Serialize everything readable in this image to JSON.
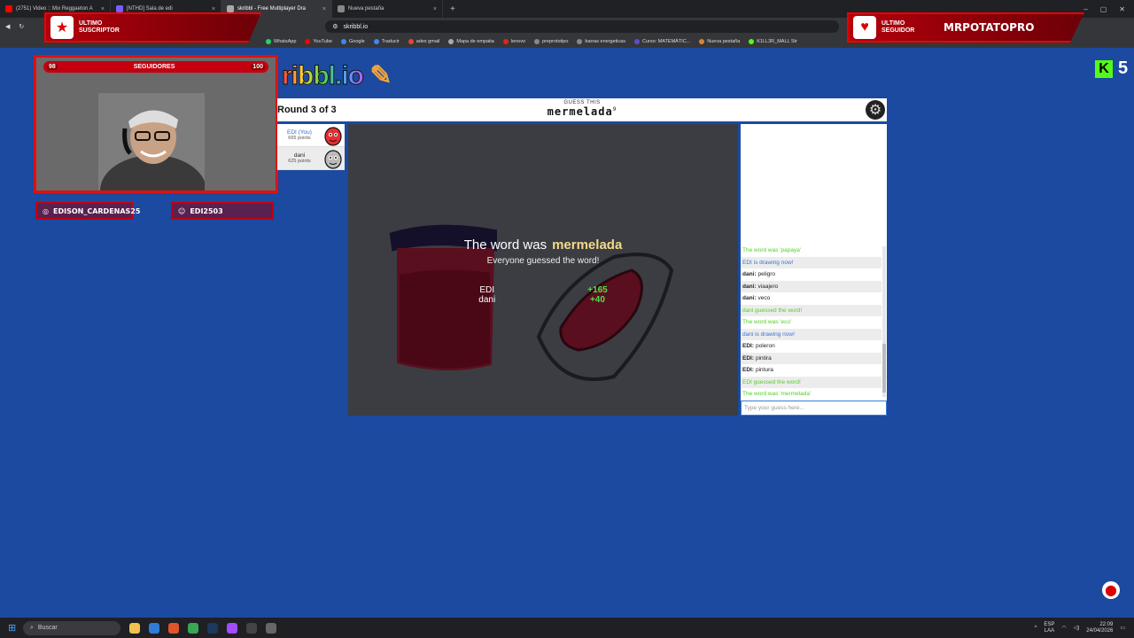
{
  "browser": {
    "tabs": [
      {
        "title": "(2751) Video :: Mix Reggaeton A",
        "color": "#ff0000",
        "active": false
      },
      {
        "title": "[NTHD] Sala de edi",
        "color": "#7b5cff",
        "active": false
      },
      {
        "title": "skribbl - Free Multiplayer Dra",
        "color": "#aaaaaa",
        "active": true
      },
      {
        "title": "Nueva pestaña",
        "color": "#888888",
        "active": false
      }
    ],
    "url": "skribbl.io",
    "bookmarks": [
      {
        "label": "WhatsApp",
        "color": "#25d366"
      },
      {
        "label": "YouTube",
        "color": "#ff0000"
      },
      {
        "label": "Google",
        "color": "#4285f4"
      },
      {
        "label": "Traducir",
        "color": "#4285f4"
      },
      {
        "label": "adex gmail",
        "color": "#ea4335"
      },
      {
        "label": "Mapa de empatia",
        "color": "#aaaaaa"
      },
      {
        "label": "lenovo",
        "color": "#e2231a"
      },
      {
        "label": "preprototipo",
        "color": "#888888"
      },
      {
        "label": "barras energeticas",
        "color": "#888888"
      },
      {
        "label": "Curso: MATEMÁTIC...",
        "color": "#5a4fcf"
      },
      {
        "label": "Nueva pestaña",
        "color": "#e08030"
      },
      {
        "label": "K1LL3R_MALL Str",
        "color": "#53fc18"
      }
    ]
  },
  "overlay": {
    "left_label": "ULTIMO SUSCRIPTOR",
    "left_name": "",
    "right_label": "ULTIMO SEGUIDOR",
    "right_name": "MRPOTATOPRO",
    "followers_label": "SEGUIDORES",
    "followers_current": "98",
    "followers_goal": "100",
    "instagram": "EDISON_CARDENAS25",
    "discord": "EDI2503",
    "kick_count": "5"
  },
  "game": {
    "logo": "ribbl.io",
    "round": "Round 3 of 3",
    "guess_label": "GUESS THIS",
    "word": "mermelada",
    "word_length": "9",
    "players": [
      {
        "name": "EDI (You)",
        "points": "665 points",
        "me": true
      },
      {
        "name": "dani",
        "points": "625 points",
        "me": false
      }
    ],
    "reveal_prefix": "The word was",
    "reveal_word": "mermelada",
    "reveal_sub": "Everyone guessed the word!",
    "round_scores": [
      {
        "name": "EDI",
        "gain": "+165"
      },
      {
        "name": "dani",
        "gain": "+40"
      }
    ],
    "chat": [
      {
        "type": "green",
        "author": "",
        "text": "The word was 'papaya'"
      },
      {
        "type": "blue",
        "author": "",
        "text": "EDI is drawing now!"
      },
      {
        "type": "normal",
        "author": "dani:",
        "text": "peligro"
      },
      {
        "type": "normal",
        "author": "dani:",
        "text": "viaajero"
      },
      {
        "type": "normal",
        "author": "dani:",
        "text": "veco"
      },
      {
        "type": "green",
        "author": "",
        "text": "dani guessed the word!"
      },
      {
        "type": "green",
        "author": "",
        "text": "The word was 'eco'"
      },
      {
        "type": "blue",
        "author": "",
        "text": "dani is drawing now!"
      },
      {
        "type": "normal",
        "author": "EDI:",
        "text": "poleron"
      },
      {
        "type": "normal",
        "author": "EDI:",
        "text": "pintira"
      },
      {
        "type": "normal",
        "author": "EDI:",
        "text": "pintura"
      },
      {
        "type": "green",
        "author": "",
        "text": "EDI guessed the word!"
      },
      {
        "type": "green",
        "author": "",
        "text": "The word was 'mermelada'"
      }
    ],
    "chat_placeholder": "Type your guess here..."
  },
  "taskbar": {
    "search_label": "Buscar",
    "lang": "ESP",
    "lang_sub": "LAA",
    "time": "22:09",
    "date": "24/04/2026"
  }
}
